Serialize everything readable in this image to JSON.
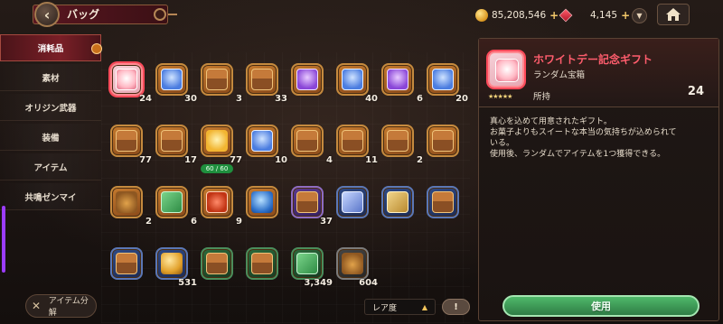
{
  "header": {
    "title": "バッグ",
    "back_icon": "chevron-left-icon",
    "currency_gold": "85,208,546",
    "currency_gem": "4,145",
    "plus": "+"
  },
  "sidebar": {
    "items": [
      {
        "label": "消耗品",
        "active": true
      },
      {
        "label": "素材",
        "active": false
      },
      {
        "label": "オリジン武器",
        "active": false
      },
      {
        "label": "装備",
        "active": false
      },
      {
        "label": "アイテム",
        "active": false
      },
      {
        "label": "共鳴ゼンマイ",
        "active": false
      }
    ],
    "split_button": "アイテム分解"
  },
  "grid": {
    "items": [
      {
        "count": "24",
        "selected": true,
        "frame": "f-orange",
        "icon": "i-heart"
      },
      {
        "count": "30",
        "frame": "f-orange",
        "icon": "i-gift-blue"
      },
      {
        "count": "3",
        "frame": "f-orange",
        "icon": "i-chest"
      },
      {
        "count": "33",
        "frame": "f-orange",
        "icon": "i-chest"
      },
      {
        "count": "",
        "frame": "f-orange",
        "icon": "i-gift-purple"
      },
      {
        "count": "40",
        "frame": "f-orange",
        "icon": "i-gift-blue"
      },
      {
        "count": "6",
        "frame": "f-orange",
        "icon": "i-gift-purple"
      },
      {
        "count": "20",
        "frame": "f-orange",
        "icon": "i-gift-blue"
      },
      {
        "count": "77",
        "frame": "f-orange",
        "icon": "i-chest"
      },
      {
        "count": "17",
        "frame": "f-orange",
        "icon": "i-chest"
      },
      {
        "count": "77",
        "badge": "60 / 60",
        "frame": "f-orange",
        "icon": "i-yellow"
      },
      {
        "count": "10",
        "frame": "f-orange",
        "icon": "i-gift-blue"
      },
      {
        "count": "4",
        "frame": "f-orange",
        "icon": "i-chest"
      },
      {
        "count": "11",
        "frame": "f-orange",
        "icon": "i-chest"
      },
      {
        "count": "2",
        "frame": "f-orange",
        "icon": "i-chest"
      },
      {
        "count": "",
        "frame": "f-orange",
        "icon": "i-chest"
      },
      {
        "count": "2",
        "frame": "f-orange",
        "icon": "i-coin-bag"
      },
      {
        "count": "6",
        "frame": "f-orange",
        "icon": "i-ticket-green"
      },
      {
        "count": "9",
        "frame": "f-orange",
        "icon": "i-ticket-red"
      },
      {
        "count": "",
        "frame": "f-orange",
        "icon": "i-orb-blue"
      },
      {
        "count": "37",
        "frame": "f-purple",
        "icon": "i-chest"
      },
      {
        "count": "",
        "frame": "f-blue",
        "icon": "i-scroll"
      },
      {
        "count": "",
        "frame": "f-blue",
        "icon": "i-map"
      },
      {
        "count": "",
        "frame": "f-blue",
        "icon": "i-chest"
      },
      {
        "count": "",
        "frame": "f-blue",
        "icon": "i-chest"
      },
      {
        "count": "531",
        "frame": "f-blue",
        "icon": "i-gold"
      },
      {
        "count": "",
        "frame": "f-green",
        "icon": "i-chest"
      },
      {
        "count": "",
        "frame": "f-green",
        "icon": "i-chest"
      },
      {
        "count": "3,349",
        "frame": "f-green",
        "icon": "i-ticket-green"
      },
      {
        "count": "604",
        "frame": "f-gray",
        "icon": "i-coin-bag"
      }
    ]
  },
  "detail": {
    "name": "ホワイトデー記念ギフト",
    "type": "ランダム宝箱",
    "own_label": "所持",
    "own_value": "24",
    "stars": "★★★★★",
    "description": [
      "真心を込めて用意されたギフト。",
      "お菓子よりもスイートな本当の気持ちが込められて",
      "いる。",
      "使用後、ランダムでアイテムを1つ獲得できる。"
    ],
    "use_button": "使用"
  },
  "footer": {
    "sort_label": "レア度",
    "sort_arrow": "▲",
    "toggle_label": "!"
  },
  "colors": {
    "accent_red": "#ff5d6d",
    "use_green": "#4fb86a",
    "sidebar_active": "#7a1f27"
  }
}
